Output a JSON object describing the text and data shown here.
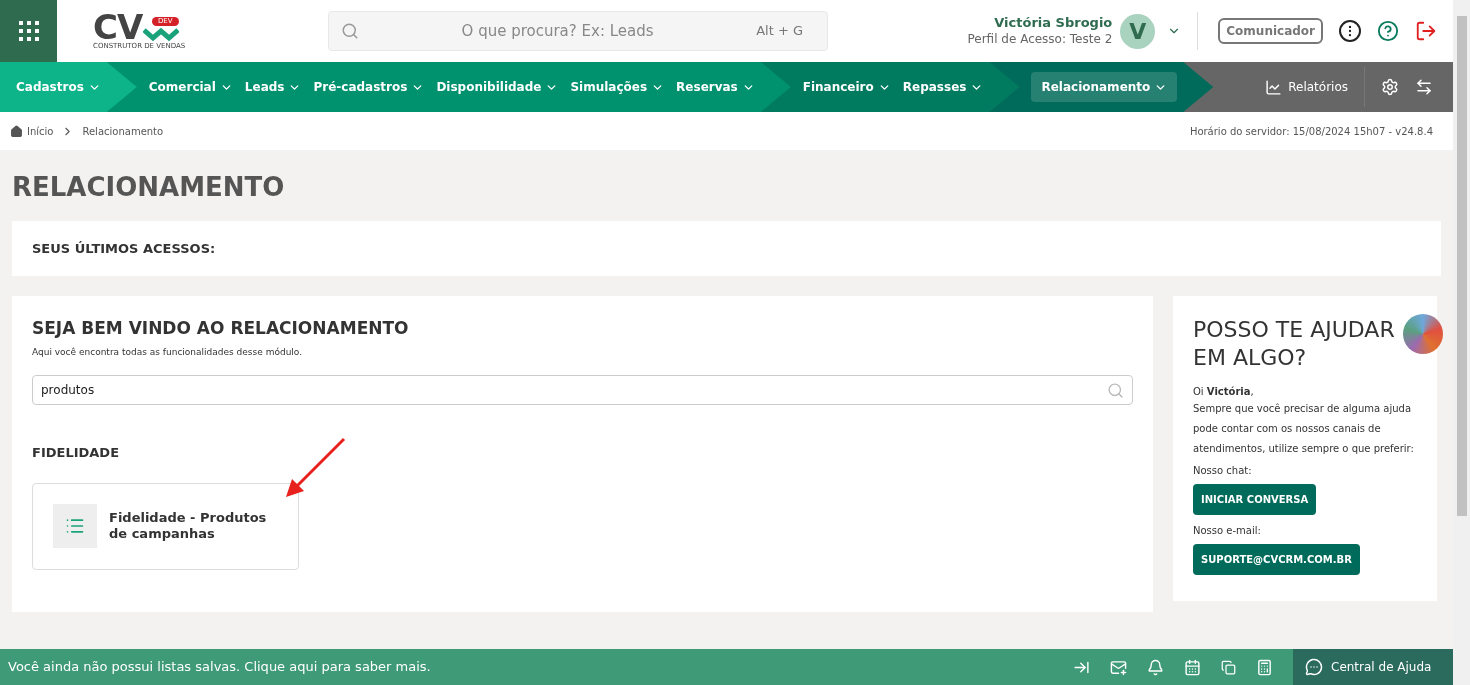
{
  "header": {
    "logo": {
      "letters": "CV",
      "badge": "DEV",
      "tagline": "CONSTRUTOR DE VENDAS"
    },
    "search": {
      "placeholder": "O que procura? Ex: Leads",
      "shortcut": "Alt + G"
    },
    "user": {
      "name": "Victória Sbrogio",
      "profile": "Perfil de Acesso: Teste 2",
      "initial": "V"
    },
    "communicator": "Comunicador"
  },
  "nav": {
    "groups": [
      {
        "color": "#0db389",
        "items": [
          {
            "label": "Cadastros",
            "selected": false
          }
        ]
      },
      {
        "color": "#00916e",
        "items": [
          {
            "label": "Comercial",
            "selected": false
          },
          {
            "label": "Leads",
            "selected": false
          },
          {
            "label": "Pré-cadastros",
            "selected": false
          },
          {
            "label": "Disponibilidade",
            "selected": false
          },
          {
            "label": "Simulações",
            "selected": false
          },
          {
            "label": "Reservas",
            "selected": false
          }
        ]
      },
      {
        "color": "#007b60",
        "items": [
          {
            "label": "Financeiro",
            "selected": false
          },
          {
            "label": "Repasses",
            "selected": false
          }
        ]
      },
      {
        "color": "#006b5a",
        "items": [
          {
            "label": "Relacionamento",
            "selected": true
          }
        ]
      }
    ],
    "reports": "Relatórios"
  },
  "breadcrumb": [
    "Início",
    "Relacionamento"
  ],
  "server_time": "Horário do servidor: 15/08/2024 15h07 - v24.8.4",
  "page_title": "RELACIONAMENTO",
  "recent": {
    "title": "SEUS ÚLTIMOS ACESSOS:"
  },
  "welcome": {
    "title": "SEJA BEM VINDO AO RELACIONAMENTO",
    "subtitle": "Aqui você encontra todas as funcionalidades desse módulo.",
    "search_value": "produtos",
    "section": "FIDELIDADE",
    "cards": [
      {
        "label": "Fidelidade - Produtos de campanhas"
      }
    ]
  },
  "help": {
    "title": "POSSO TE AJUDAR EM ALGO?",
    "greeting": "Oi **Victória**,",
    "text": "Sempre que você precisar de alguma ajuda pode contar com os nossos canais de atendimentos, utilize sempre o que preferir:",
    "chat_label": "Nosso chat:",
    "chat_button": "INICIAR CONVERSA",
    "email_label": "Nosso e-mail:",
    "email_button": "SUPORTE@CVCRM.COM.BR"
  },
  "footer": {
    "message": "Você ainda não possui listas salvas. Clique aqui para saber mais.",
    "help_center": "Central de Ajuda"
  }
}
